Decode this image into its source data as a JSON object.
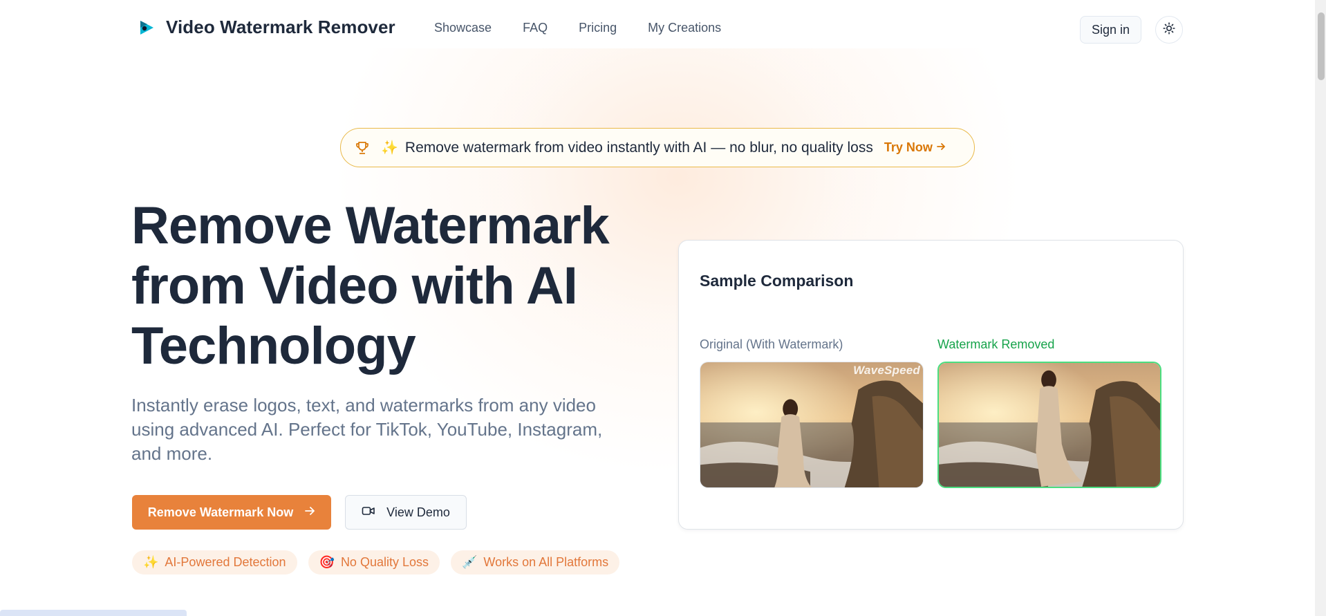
{
  "header": {
    "brand": "Video Watermark Remover",
    "nav": [
      "Showcase",
      "FAQ",
      "Pricing",
      "My Creations"
    ],
    "signin_label": "Sign in"
  },
  "announcement": {
    "icon": "trophy-icon",
    "spark": "✨",
    "text": "Remove watermark from video instantly with AI — no blur, no quality loss",
    "cta": "Try Now"
  },
  "hero": {
    "title_lines": [
      "Remove Watermark",
      "from Video with AI",
      "Technology"
    ],
    "subtitle": "Instantly erase logos, text, and watermarks from any video using advanced AI. Perfect for TikTok, YouTube, Instagram, and more.",
    "primary_cta": "Remove Watermark Now",
    "secondary_cta": "View Demo",
    "chips": [
      {
        "emoji": "✨",
        "label": "AI-Powered Detection"
      },
      {
        "emoji": "🎯",
        "label": "No Quality Loss"
      },
      {
        "emoji": "💉",
        "label": "Works on All Platforms"
      }
    ]
  },
  "sample": {
    "title": "Sample Comparison",
    "original_label": "Original (With Watermark)",
    "removed_label": "Watermark Removed",
    "watermark_text": "WaveSpeed"
  },
  "colors": {
    "accent": "#e8823b",
    "gold": "#d97706",
    "success": "#16a34a",
    "text": "#1e293b",
    "muted": "#64748b"
  }
}
